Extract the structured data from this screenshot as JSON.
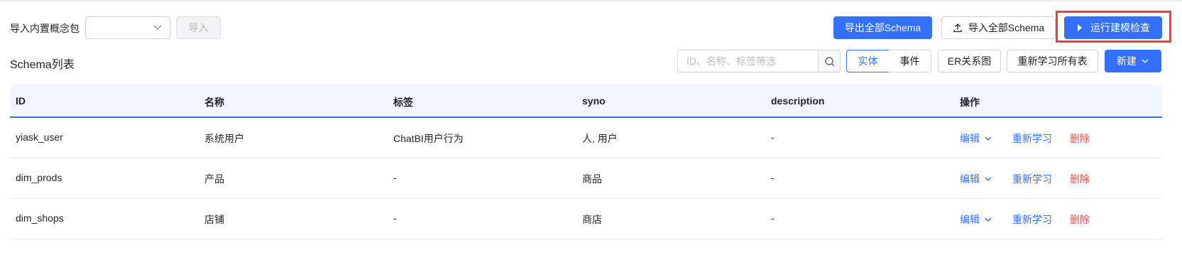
{
  "import_bar": {
    "label": "导入内置概念包",
    "select_value": "",
    "import_button": "导入"
  },
  "actions": {
    "export_all": "导出全部Schema",
    "import_all": "导入全部Schema",
    "run_check": "运行建模检查"
  },
  "list": {
    "title": "Schema列表",
    "filter_placeholder": "ID、名称、标签筛选",
    "tabs": [
      "实体",
      "事件"
    ],
    "active_tab": "实体",
    "er_button": "ER关系图",
    "relearn_all_button": "重新学习所有表",
    "new_button": "新建"
  },
  "table": {
    "columns": [
      "ID",
      "名称",
      "标签",
      "syno",
      "description",
      "操作"
    ],
    "rows": [
      {
        "id": "yiask_user",
        "name": "系统用户",
        "tag": "ChatBI用户行为",
        "syno": "人, 用户",
        "description": "-"
      },
      {
        "id": "dim_prods",
        "name": "产品",
        "tag": "-",
        "syno": "商品",
        "description": "-"
      },
      {
        "id": "dim_shops",
        "name": "店铺",
        "tag": "-",
        "syno": "商店",
        "description": "-"
      }
    ],
    "row_actions": {
      "edit": "编辑",
      "relearn": "重新学习",
      "delete": "删除"
    }
  },
  "colors": {
    "primary": "#3370ff",
    "danger": "#f54a45",
    "header_bg": "#f0f5ff",
    "highlight_box": "#e8413b"
  },
  "icons": {
    "select_chevron": "chevron-down-icon",
    "import_all": "upload-icon",
    "run_check": "play-icon",
    "search": "search-icon",
    "new_dropdown": "chevron-down-icon",
    "edit_dropdown": "chevron-down-icon"
  }
}
